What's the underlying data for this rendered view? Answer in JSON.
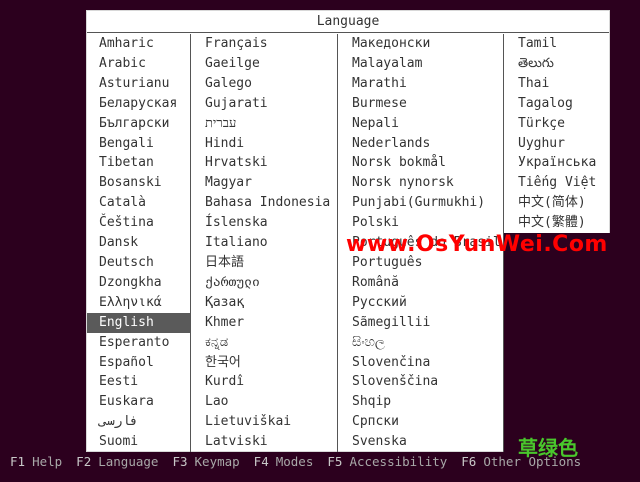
{
  "dialog": {
    "title": "Language",
    "selected": "English",
    "columns": [
      [
        "Amharic",
        "Arabic",
        "Asturianu",
        "Беларуская",
        "Български",
        "Bengali",
        "Tibetan",
        "Bosanski",
        "Català",
        "Čeština",
        "Dansk",
        "Deutsch",
        "Dzongkha",
        "Ελληνικά",
        "English",
        "Esperanto",
        "Español",
        "Eesti",
        "Euskara",
        "فارسی",
        "Suomi"
      ],
      [
        "Français",
        "Gaeilge",
        "Galego",
        "Gujarati",
        "עברית",
        "Hindi",
        "Hrvatski",
        "Magyar",
        "Bahasa Indonesia",
        "Íslenska",
        "Italiano",
        "日本語",
        "ქართული",
        "Қазақ",
        "Khmer",
        "ಕನ್ನಡ",
        "한국어",
        "Kurdî",
        "Lao",
        "Lietuviškai",
        "Latviski"
      ],
      [
        "Македонски",
        "Malayalam",
        "Marathi",
        "Burmese",
        "Nepali",
        "Nederlands",
        "Norsk bokmål",
        "Norsk nynorsk",
        "Punjabi(Gurmukhi)",
        "Polski",
        "Português do Brasil",
        "Português",
        "Română",
        "Русский",
        "Sãmegillii",
        "සිංහල",
        "Slovenčina",
        "Slovenščina",
        "Shqip",
        "Српски",
        "Svenska"
      ],
      [
        "Tamil",
        "తెలుగు",
        "Thai",
        "Tagalog",
        "Türkçe",
        "Uyghur",
        "Українська",
        "Tiếng Việt",
        "中文(简体)",
        "中文(繁體)"
      ]
    ]
  },
  "footer": [
    {
      "key": "F1",
      "label": "Help"
    },
    {
      "key": "F2",
      "label": "Language"
    },
    {
      "key": "F3",
      "label": "Keymap"
    },
    {
      "key": "F4",
      "label": "Modes"
    },
    {
      "key": "F5",
      "label": "Accessibility"
    },
    {
      "key": "F6",
      "label": "Other Options"
    }
  ],
  "watermark": {
    "url_text": "www.OsYunWei.Com",
    "corner_text": "草绿色"
  },
  "colors": {
    "background": "#2c001e",
    "selection": "#5a5a5a",
    "watermark_red": "#ff0000",
    "watermark_green": "#49c72c"
  }
}
